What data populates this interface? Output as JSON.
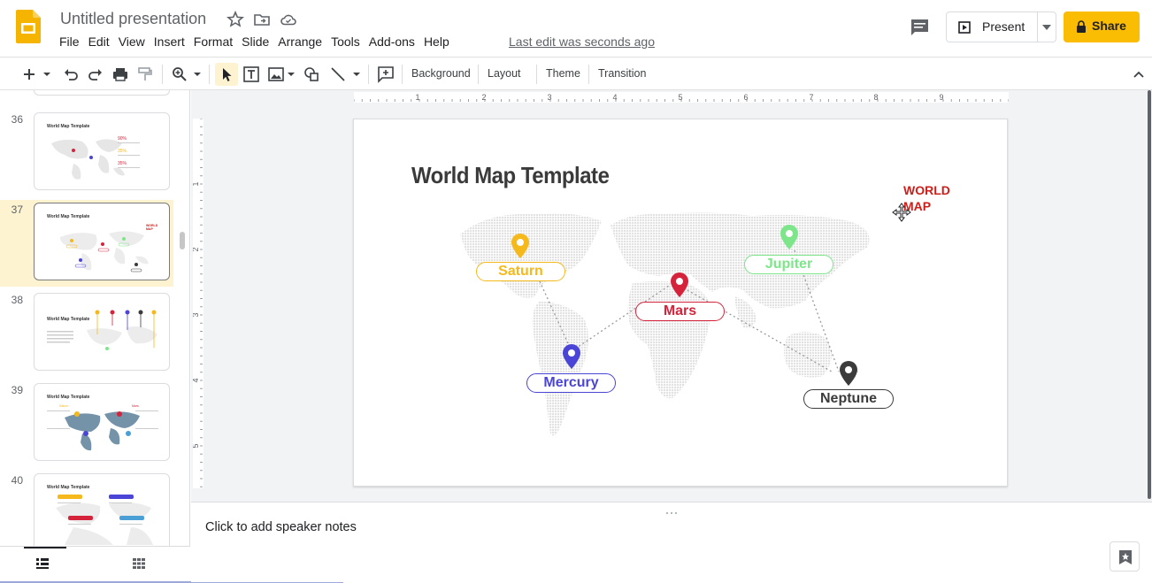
{
  "header": {
    "title": "Untitled presentation",
    "menu": [
      "File",
      "Edit",
      "View",
      "Insert",
      "Format",
      "Slide",
      "Arrange",
      "Tools",
      "Add-ons",
      "Help"
    ],
    "last_edit": "Last edit was seconds ago",
    "present_label": "Present",
    "share_label": "Share"
  },
  "toolbar": {
    "background": "Background",
    "layout": "Layout",
    "theme": "Theme",
    "transition": "Transition"
  },
  "filmstrip": {
    "slides": [
      {
        "num": "36",
        "title": "World Map Template"
      },
      {
        "num": "37",
        "title": "World Map Template"
      },
      {
        "num": "38",
        "title": "World Map Template"
      },
      {
        "num": "39",
        "title": "World Map Template"
      },
      {
        "num": "40",
        "title": "World Map Template"
      }
    ]
  },
  "rulers": {
    "h_labels": [
      "1",
      "2",
      "3",
      "4",
      "5",
      "6",
      "7",
      "8",
      "9"
    ],
    "v_labels": [
      "1",
      "2",
      "3",
      "4",
      "5"
    ]
  },
  "slide": {
    "title": "World Map Template",
    "wordart_line1": "WORLD",
    "wordart_line2": "MAP",
    "pins": [
      {
        "name": "Saturn",
        "color": "#f5b91c"
      },
      {
        "name": "Jupiter",
        "color": "#7ee68a"
      },
      {
        "name": "Mars",
        "color": "#d5233b"
      },
      {
        "name": "Mercury",
        "color": "#4a45d6"
      },
      {
        "name": "Neptune",
        "color": "#3b3b3b"
      }
    ]
  },
  "notes": {
    "placeholder": "Click to add speaker notes"
  },
  "colors": {
    "accent": "#fbbc04",
    "selection": "#fdf3d0",
    "wordart": "#cc1f1a"
  }
}
